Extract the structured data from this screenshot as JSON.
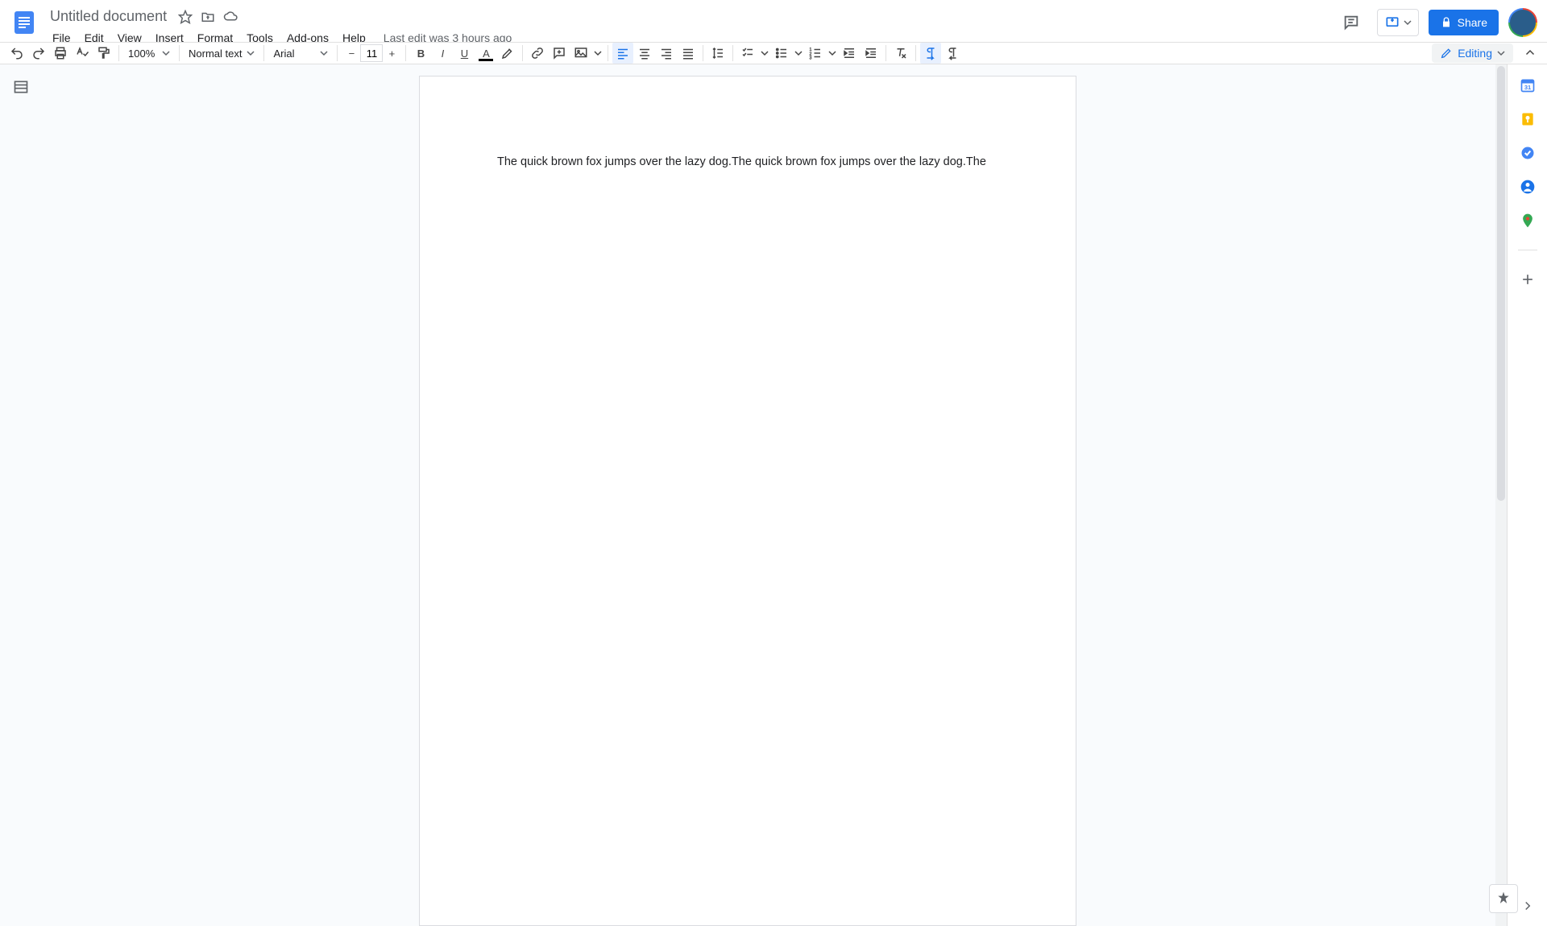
{
  "header": {
    "doc_title": "Untitled document",
    "last_edit": "Last edit was 3 hours ago",
    "share_label": "Share"
  },
  "menu": {
    "items": [
      "File",
      "Edit",
      "View",
      "Insert",
      "Format",
      "Tools",
      "Add-ons",
      "Help"
    ]
  },
  "toolbar": {
    "zoom": "100%",
    "style": "Normal text",
    "font": "Arial",
    "font_size": "11",
    "mode": "Editing"
  },
  "doc": {
    "content": "The quick brown fox jumps over the lazy dog.The quick brown fox jumps over the lazy dog.The"
  }
}
